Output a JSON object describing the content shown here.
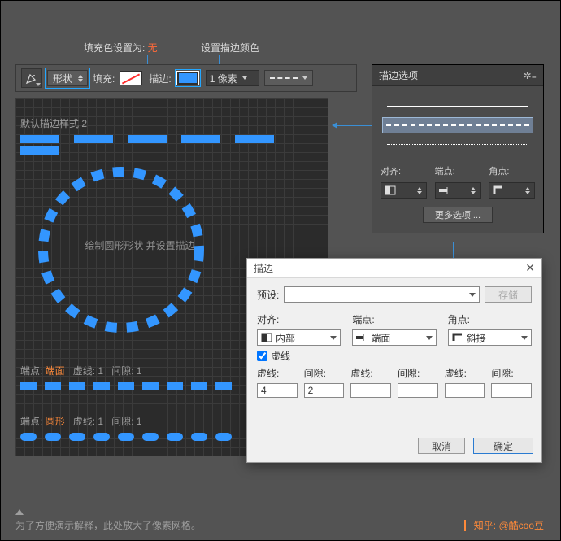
{
  "annotations": {
    "fill_none": {
      "prefix": "填充色设置为: ",
      "value": "无"
    },
    "stroke_color": "设置描边颜色"
  },
  "toolbar": {
    "shape_mode": "形状",
    "fill_label": "填充:",
    "stroke_label": "描边:",
    "stroke_weight": "1 像素"
  },
  "canvas": {
    "default_style_label": "默认描边样式 2",
    "circle_caption": "绘制圆形形状  并设置描边",
    "row_a_cap_label": "端点: ",
    "row_a_cap_value": "端面",
    "row_a_dash_label": "虚线: ",
    "row_a_dash_value": "1",
    "row_a_gap_label": "间隙: ",
    "row_a_gap_value": "1",
    "row_b_cap_label": "端点: ",
    "row_b_cap_value": "圆形",
    "row_b_dash_label": "虚线: ",
    "row_b_dash_value": "1",
    "row_b_gap_label": "间隙: ",
    "row_b_gap_value": "1"
  },
  "panel": {
    "title": "描边选项",
    "align_label": "对齐:",
    "cap_label": "端点:",
    "corner_label": "角点:",
    "more_options": "更多选项 ..."
  },
  "dialog": {
    "title": "描边",
    "preset_label": "预设:",
    "save_btn": "存储",
    "align_label": "对齐:",
    "align_value": "内部",
    "cap_label": "端点:",
    "cap_value": "端面",
    "corner_label": "角点:",
    "corner_value": "斜接",
    "dash_checkbox": "虚线",
    "col_dash": "虚线:",
    "col_gap": "间隙:",
    "dash1": "4",
    "gap1": "2",
    "cancel": "取消",
    "ok": "确定"
  },
  "footer": {
    "note": "为了方便演示解释，此处放大了像素网格。",
    "credit_label": "知乎: ",
    "credit_name": "@酷coo豆"
  }
}
